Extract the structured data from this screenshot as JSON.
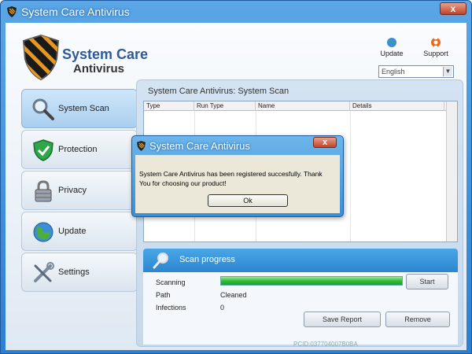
{
  "window": {
    "title": "System Care Antivirus",
    "close_label": "x"
  },
  "logo": {
    "line1": "System Care",
    "line2": "Antivirus"
  },
  "header": {
    "update_label": "Update",
    "support_label": "Support",
    "language_value": "English"
  },
  "nav": {
    "items": [
      {
        "label": "System Scan",
        "icon": "magnifier-icon",
        "active": true
      },
      {
        "label": "Protection",
        "icon": "shield-check-icon",
        "active": false
      },
      {
        "label": "Privacy",
        "icon": "padlock-icon",
        "active": false
      },
      {
        "label": "Update",
        "icon": "globe-icon",
        "active": false
      },
      {
        "label": "Settings",
        "icon": "tools-icon",
        "active": false
      }
    ]
  },
  "scan": {
    "panel_title": "System Care Antivirus: System Scan",
    "columns": [
      "Type",
      "Run Type",
      "Name",
      "Details"
    ],
    "progress_title": "Scan progress",
    "rows": [
      {
        "label": "Scanning",
        "value": ""
      },
      {
        "label": "Path",
        "value": "Cleaned"
      },
      {
        "label": "Infections",
        "value": "0"
      }
    ],
    "progress_fraction": 1.0,
    "start_label": "Start",
    "save_report_label": "Save Report",
    "remove_label": "Remove",
    "pcid": "PCID:037704007B0BA"
  },
  "dialog": {
    "title": "System Care Antivirus",
    "close_label": "x",
    "message": "System Care Antivirus has been registered succesfully. Thank You  for choosing our product!",
    "ok_label": "Ok"
  },
  "colors": {
    "titlebar": "#3a8fd6",
    "progress": "#2fbf3a",
    "close": "#c1432a"
  }
}
